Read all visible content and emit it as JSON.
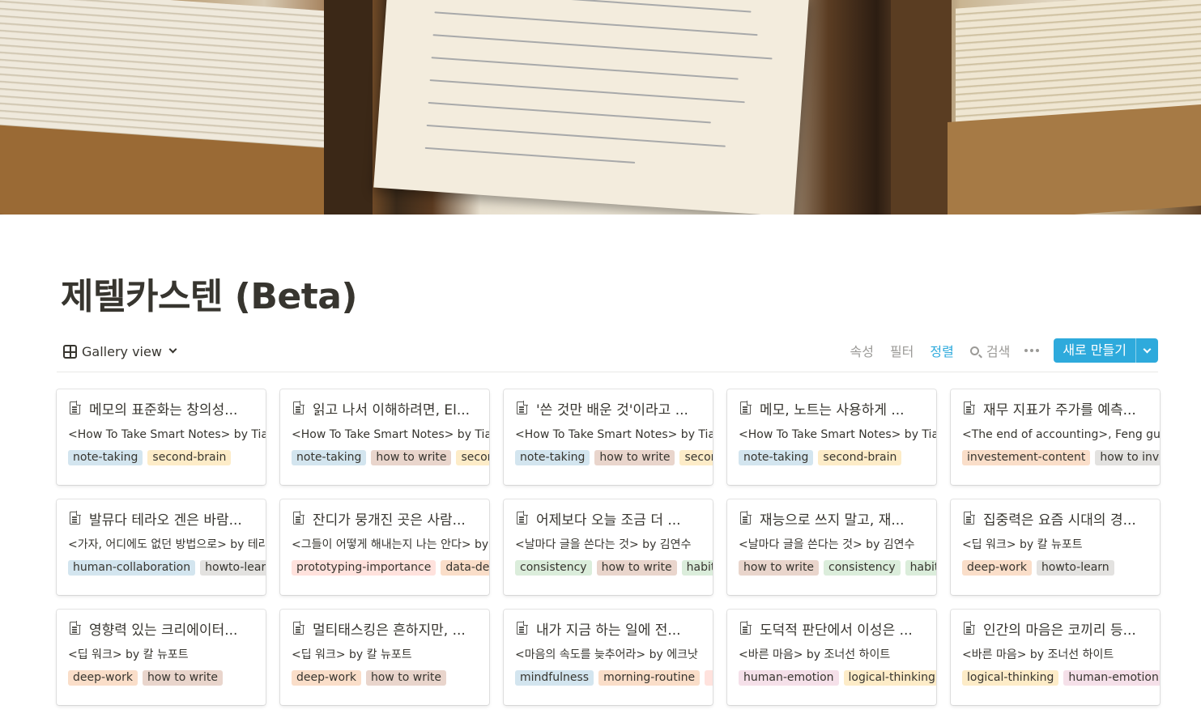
{
  "page": {
    "title": "제텔카스텐 (Beta)"
  },
  "toolbar": {
    "view_label": "Gallery view",
    "properties_label": "속성",
    "filter_label": "필터",
    "sort_label": "정렬",
    "search_label": "검색",
    "new_label": "새로 만들기",
    "accent_color": "#2eaadc"
  },
  "tag_colors": {
    "blue": "#d3e5ef",
    "yellow": "#fdecc8",
    "brown": "#e9d5cc",
    "orange": "#fadec9",
    "gray": "#e3e2e0",
    "green": "#dbeddb",
    "red": "#ffe2dd",
    "pink": "#f5e0e9"
  },
  "cards": [
    {
      "title": "메모의 표준화는 창의성...",
      "source": "<How To Take Smart Notes> by Tiago",
      "tags": [
        {
          "label": "note-taking",
          "color": "blue"
        },
        {
          "label": "second-brain",
          "color": "yellow"
        }
      ]
    },
    {
      "title": "읽고 나서 이해하려면, El...",
      "source": "<How To Take Smart Notes> by Tiago",
      "tags": [
        {
          "label": "note-taking",
          "color": "blue"
        },
        {
          "label": "how to write",
          "color": "brown"
        },
        {
          "label": "second-brain",
          "color": "yellow"
        }
      ]
    },
    {
      "title": "'쓴 것만 배운 것'이라고 ...",
      "source": "<How To Take Smart Notes> by Tiago",
      "tags": [
        {
          "label": "note-taking",
          "color": "blue"
        },
        {
          "label": "how to write",
          "color": "brown"
        },
        {
          "label": "second-brain",
          "color": "yellow"
        }
      ]
    },
    {
      "title": "메모, 노트는 사용하게 ...",
      "source": "<How To Take Smart Notes> by Tiago",
      "tags": [
        {
          "label": "note-taking",
          "color": "blue"
        },
        {
          "label": "second-brain",
          "color": "yellow"
        }
      ]
    },
    {
      "title": "재무 지표가 주가를 예측...",
      "source": "<The end of accounting>, Feng gu",
      "tags": [
        {
          "label": "investement-content",
          "color": "orange"
        },
        {
          "label": "how to invest",
          "color": "gray"
        }
      ]
    },
    {
      "title": "발뮤다 테라오 겐은 바람...",
      "source": "<가자, 어디에도 없던 방법으로> by 테라오 겐",
      "tags": [
        {
          "label": "human-collaboration",
          "color": "blue"
        },
        {
          "label": "howto-learn",
          "color": "gray"
        }
      ]
    },
    {
      "title": "잔디가 뭉개진 곳은 사람...",
      "source": "<그들이 어떻게 해내는지 나는 안다> by",
      "tags": [
        {
          "label": "prototyping-importance",
          "color": "red"
        },
        {
          "label": "data-design",
          "color": "orange"
        }
      ]
    },
    {
      "title": "어제보다 오늘 조금 더 ...",
      "source": "<날마다 글을 쓴다는 것> by 김연수",
      "tags": [
        {
          "label": "consistency",
          "color": "green"
        },
        {
          "label": "how to write",
          "color": "brown"
        },
        {
          "label": "habit",
          "color": "green"
        }
      ]
    },
    {
      "title": "재능으로 쓰지 말고, 재...",
      "source": "<날마다 글을 쓴다는 것> by 김연수",
      "tags": [
        {
          "label": "how to write",
          "color": "brown"
        },
        {
          "label": "consistency",
          "color": "green"
        },
        {
          "label": "habit",
          "color": "green"
        }
      ]
    },
    {
      "title": "집중력은 요즘 시대의 경...",
      "source": "<딥 워크> by 칼 뉴포트",
      "tags": [
        {
          "label": "deep-work",
          "color": "orange"
        },
        {
          "label": "howto-learn",
          "color": "gray"
        }
      ]
    },
    {
      "title": "영향력 있는 크리에이터...",
      "source": "<딥 워크> by 칼 뉴포트",
      "tags": [
        {
          "label": "deep-work",
          "color": "orange"
        },
        {
          "label": "how to write",
          "color": "brown"
        }
      ]
    },
    {
      "title": "멀티태스킹은 흔하지만, ...",
      "source": "<딥 워크> by 칼 뉴포트",
      "tags": [
        {
          "label": "deep-work",
          "color": "orange"
        },
        {
          "label": "how to write",
          "color": "brown"
        }
      ]
    },
    {
      "title": "내가 지금 하는 일에 전...",
      "source": "<마음의 속도를 늦추어라> by 에크낫",
      "tags": [
        {
          "label": "mindfulness",
          "color": "blue"
        },
        {
          "label": "morning-routine",
          "color": "orange"
        },
        {
          "label": "",
          "color": "red"
        }
      ]
    },
    {
      "title": "도덕적 판단에서 이성은 ...",
      "source": "<바른 마음> by 조너선 하이트",
      "tags": [
        {
          "label": "human-emotion",
          "color": "pink"
        },
        {
          "label": "logical-thinking",
          "color": "yellow"
        }
      ]
    },
    {
      "title": "인간의 마음은 코끼리 등...",
      "source": "<바른 마음> by 조너선 하이트",
      "tags": [
        {
          "label": "logical-thinking",
          "color": "yellow"
        },
        {
          "label": "human-emotion",
          "color": "pink"
        }
      ]
    }
  ]
}
